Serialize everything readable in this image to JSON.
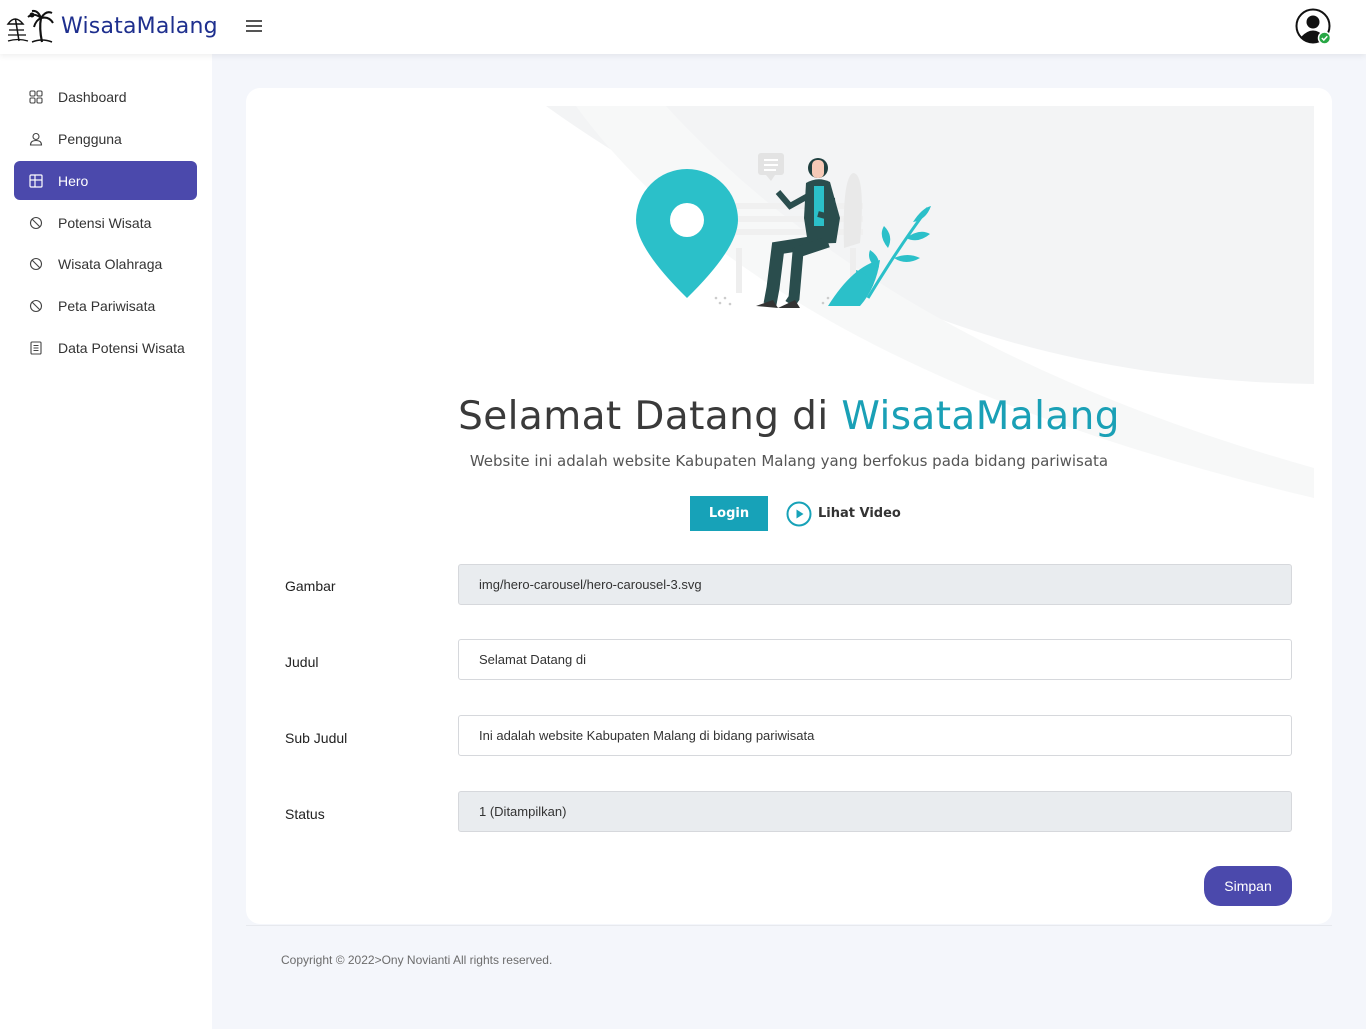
{
  "brand": {
    "name": "WisataMalang"
  },
  "sidebar": {
    "items": [
      {
        "label": "Dashboard",
        "icon": "grid-icon"
      },
      {
        "label": "Pengguna",
        "icon": "user-icon"
      },
      {
        "label": "Hero",
        "icon": "layout-icon",
        "active": true
      },
      {
        "label": "Potensi Wisata",
        "icon": "block-icon"
      },
      {
        "label": "Wisata Olahraga",
        "icon": "block-icon"
      },
      {
        "label": "Peta Pariwisata",
        "icon": "block-icon"
      },
      {
        "label": "Data Potensi Wisata",
        "icon": "document-icon"
      }
    ]
  },
  "hero": {
    "title_prefix": "Selamat Datang di",
    "title_accent": "WisataMalang",
    "subtitle": "Website ini adalah website Kabupaten Malang yang berfokus pada bidang pariwisata",
    "login_label": "Login",
    "video_label": "Lihat Video"
  },
  "form": {
    "gambar": {
      "label": "Gambar",
      "value": "img/hero-carousel/hero-carousel-3.svg"
    },
    "judul": {
      "label": "Judul",
      "value": "Selamat Datang di"
    },
    "sub_judul": {
      "label": "Sub Judul",
      "value": "Ini adalah website Kabupaten Malang di bidang pariwisata"
    },
    "status": {
      "label": "Status",
      "value": "1 (Ditampilkan)"
    },
    "save_label": "Simpan"
  },
  "footer": {
    "text": "Copyright © 2022>Ony Novianti All rights reserved."
  },
  "colors": {
    "primary": "#4b49ac",
    "accent": "#1aa0b6",
    "teal": "#17a2b8"
  }
}
